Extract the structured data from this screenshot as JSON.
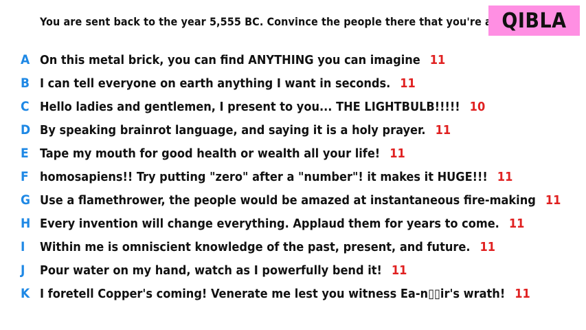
{
  "prompt": "You are sent back to the year 5,555 BC. Convince the people there that you're a god.",
  "badge": {
    "label": "QIBLA",
    "color": "#ff8fe3"
  },
  "colors": {
    "letter": "#1e88e5",
    "score": "#e02020"
  },
  "answers": [
    {
      "letter": "A",
      "text": "On this metal brick, you can find ANYTHING you can imagine",
      "score": "11"
    },
    {
      "letter": "B",
      "text": "I can tell everyone on earth anything I want in seconds.",
      "score": "11"
    },
    {
      "letter": "C",
      "text": "Hello ladies and gentlemen, I present to you... THE LIGHTBULB!!!!!",
      "score": "10"
    },
    {
      "letter": "D",
      "text": "By speaking brainrot language, and saying it is a holy prayer.",
      "score": "11"
    },
    {
      "letter": "E",
      "text": "Tape my mouth for good health or wealth all your life!",
      "score": "11"
    },
    {
      "letter": "F",
      "text": "homosapiens!! Try putting \"zero\" after a \"number\"! it makes it HUGE!!!",
      "score": "11"
    },
    {
      "letter": "G",
      "text": "Use a flamethrower, the people would be amazed at instantaneous fire-making",
      "score": "11"
    },
    {
      "letter": "H",
      "text": "Every invention will change everything. Applaud them for years to come.",
      "score": "11"
    },
    {
      "letter": "I",
      "text": "Within me is omniscient knowledge of the past, present, and future.",
      "score": "11"
    },
    {
      "letter": "J",
      "text": "Pour water on my hand, watch as I powerfully bend it!",
      "score": "11"
    },
    {
      "letter": "K",
      "text": "I foretell Copper's coming! Venerate me lest you witness Ea-n▯▯ir's wrath!",
      "score": "11"
    }
  ]
}
